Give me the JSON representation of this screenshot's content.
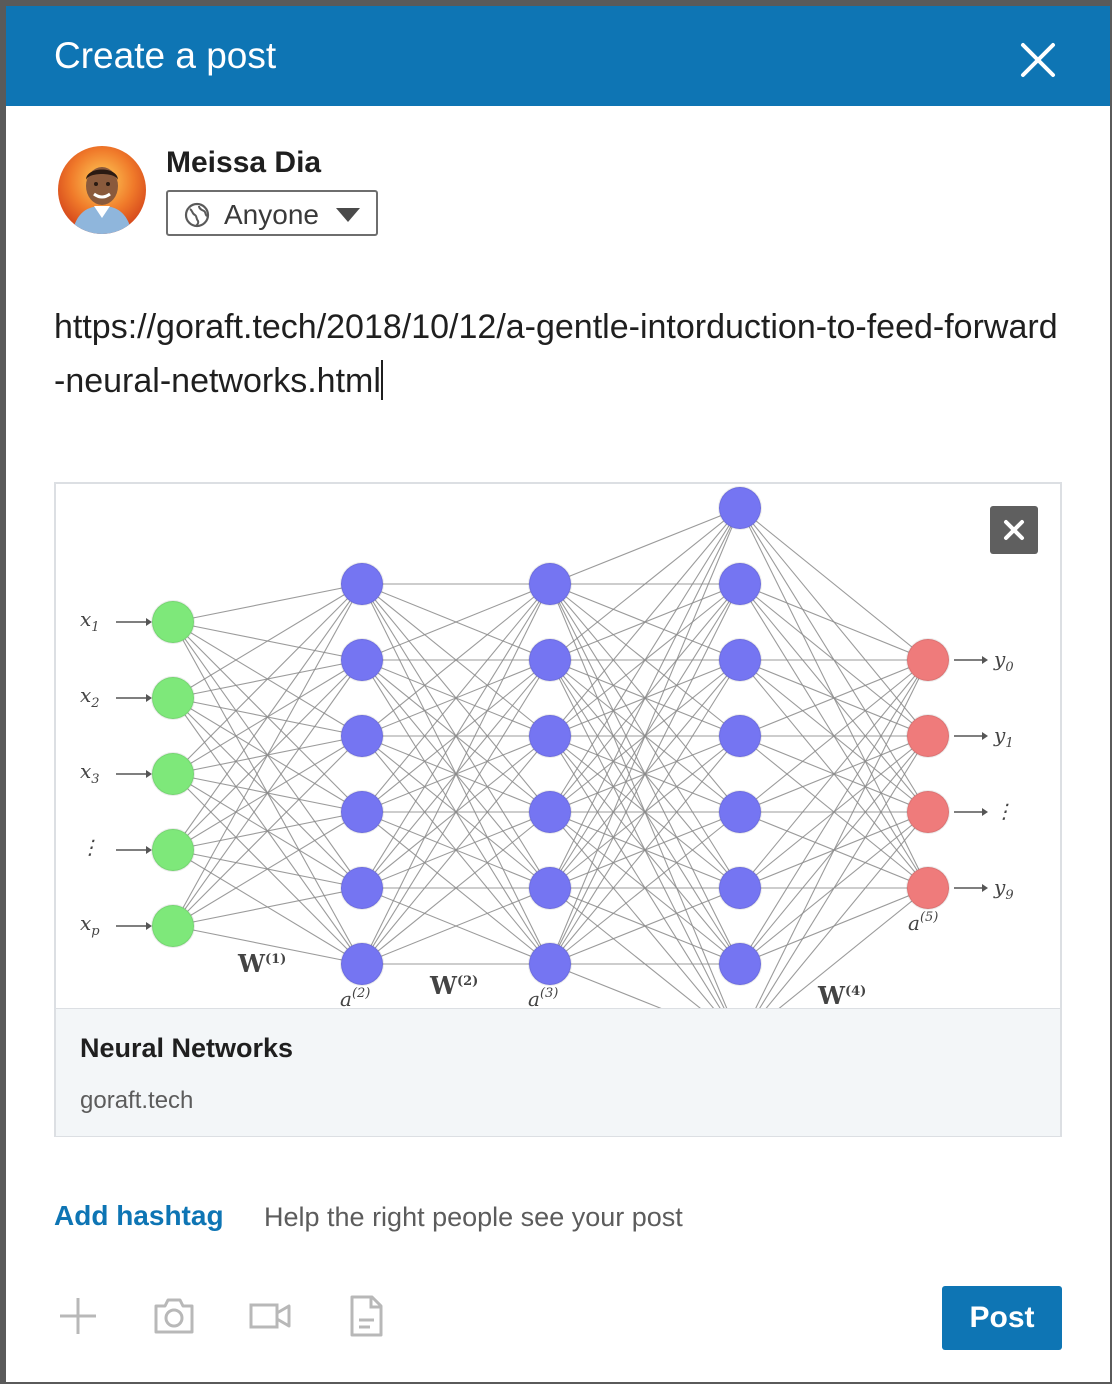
{
  "dialog": {
    "title": "Create a post"
  },
  "author": {
    "name": "Meissa Dia",
    "visibility": "Anyone"
  },
  "post": {
    "text": "https://goraft.tech/2018/10/12/a-gentle-intorduction-to-feed-forward-neural-networks.html"
  },
  "link_preview": {
    "title": "Neural Networks",
    "domain": "goraft.tech",
    "image": {
      "input_labels": [
        "x",
        "x",
        "x",
        "⋮",
        "x"
      ],
      "input_subscripts": [
        "1",
        "2",
        "3",
        "",
        "p"
      ],
      "output_labels": [
        "y",
        "y",
        "⋮",
        "y"
      ],
      "output_subscripts": [
        "0",
        "1",
        "",
        "9"
      ],
      "weight_labels": [
        "W",
        "W",
        "W"
      ],
      "weight_superscripts": [
        "(1)",
        "(2)",
        "(4)"
      ],
      "activation_labels": [
        "a",
        "a",
        "a"
      ],
      "activation_superscripts": [
        "(2)",
        "(3)",
        "(5)"
      ],
      "colors": {
        "input": "#7ee87a",
        "hidden": "#7575f2",
        "output": "#ef7b7b",
        "edge": "#8a8a8a"
      }
    }
  },
  "hashtag": {
    "button": "Add hashtag",
    "hint": "Help the right people see your post"
  },
  "toolbar": {
    "icons": [
      "plus-icon",
      "camera-icon",
      "video-icon",
      "document-icon"
    ],
    "post_label": "Post"
  },
  "colors": {
    "header": "#0e75b4",
    "accent": "#0e75b4"
  }
}
